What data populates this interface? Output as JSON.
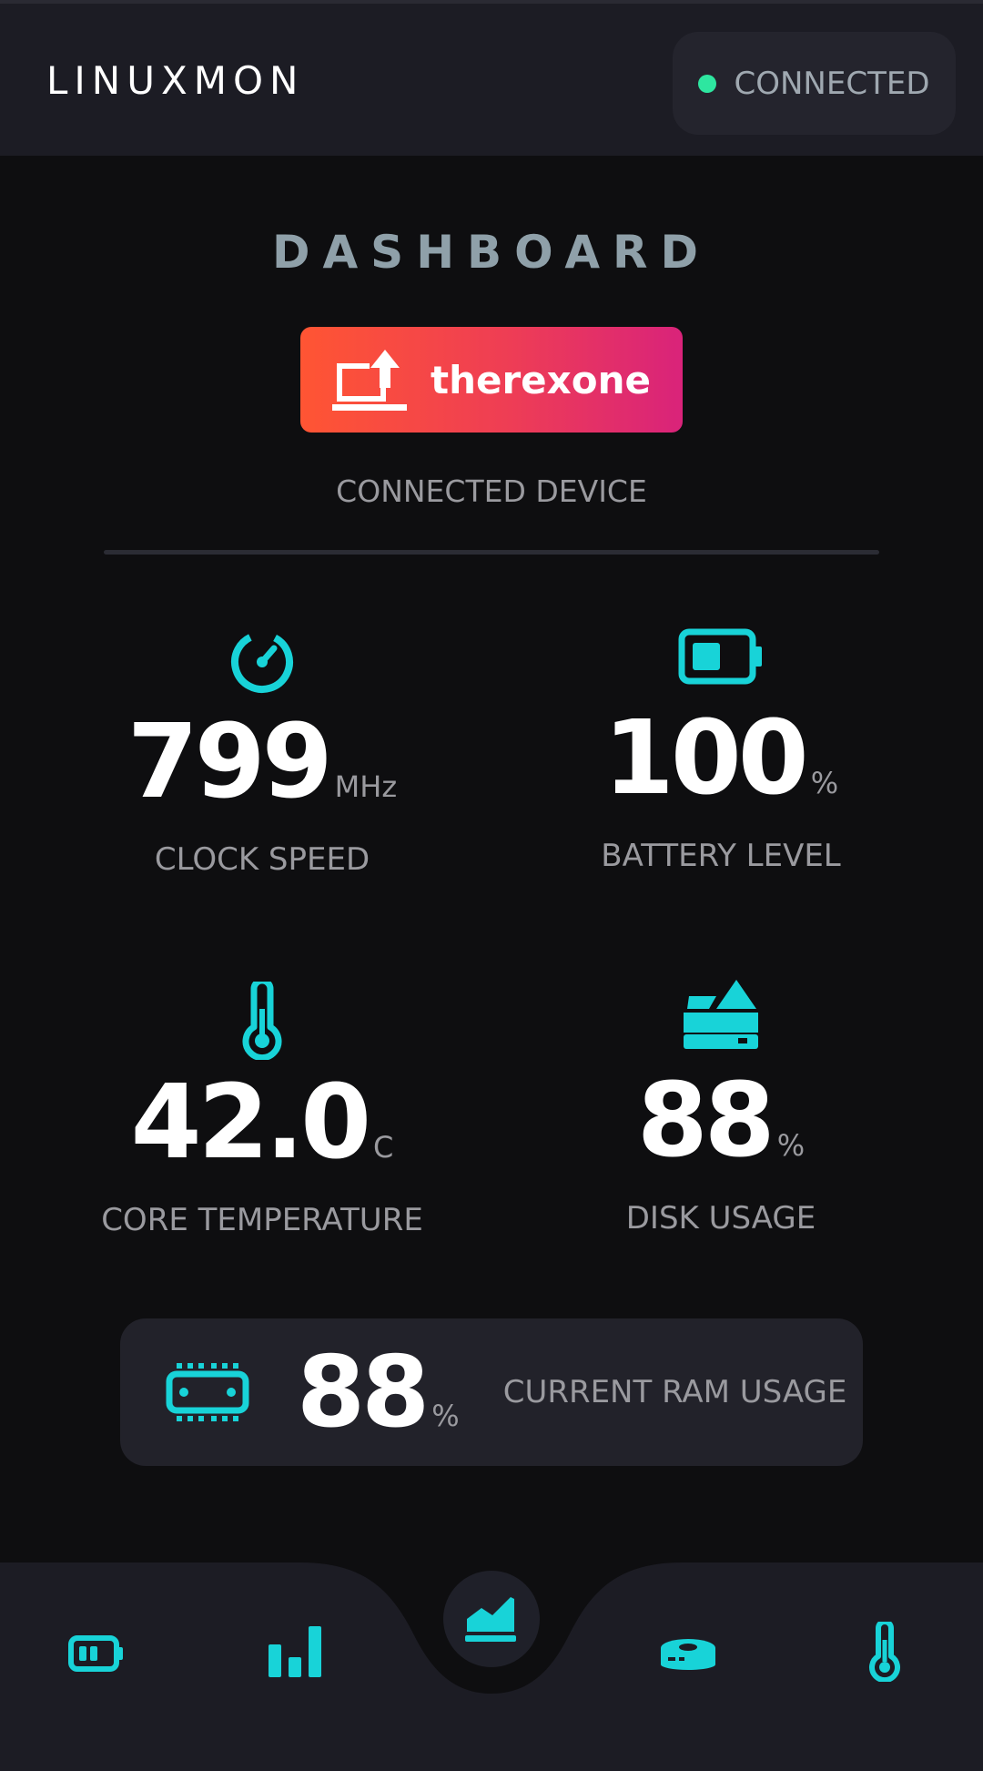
{
  "header": {
    "brand": "LINUXMON",
    "status_text": "CONNECTED",
    "status_color": "#2ee6a0"
  },
  "dashboard": {
    "title": "DASHBOARD",
    "device": {
      "name": "therexone",
      "icon": "laptop-upload-icon",
      "caption": "CONNECTED DEVICE"
    }
  },
  "stats": {
    "clock": {
      "icon": "speedometer-icon",
      "value": "799",
      "unit": "MHz",
      "label": "CLOCK SPEED"
    },
    "battery": {
      "icon": "battery-icon",
      "value": "100",
      "unit": "%",
      "label": "BATTERY LEVEL"
    },
    "temperature": {
      "icon": "thermometer-icon",
      "value": "42.0",
      "unit": "C",
      "label": "CORE TEMPERATURE"
    },
    "disk": {
      "icon": "hard-drive-icon",
      "value": "88",
      "unit": "%",
      "label": "DISK USAGE"
    }
  },
  "ram": {
    "icon": "memory-chip-icon",
    "value": "88",
    "unit": "%",
    "label": "CURRENT RAM USAGE"
  },
  "nav": {
    "items": [
      {
        "name": "battery",
        "icon": "battery-icon"
      },
      {
        "name": "stats",
        "icon": "bar-chart-icon"
      },
      {
        "name": "dashboard",
        "icon": "area-chart-icon",
        "active": true
      },
      {
        "name": "disk",
        "icon": "hard-drive-icon"
      },
      {
        "name": "temperature",
        "icon": "thermometer-icon"
      }
    ]
  },
  "colors": {
    "accent": "#18d3d8",
    "background": "#0e0e10",
    "surface": "#1c1c24",
    "badge_gradient_start": "#ff5533",
    "badge_gradient_end": "#d9237a"
  }
}
